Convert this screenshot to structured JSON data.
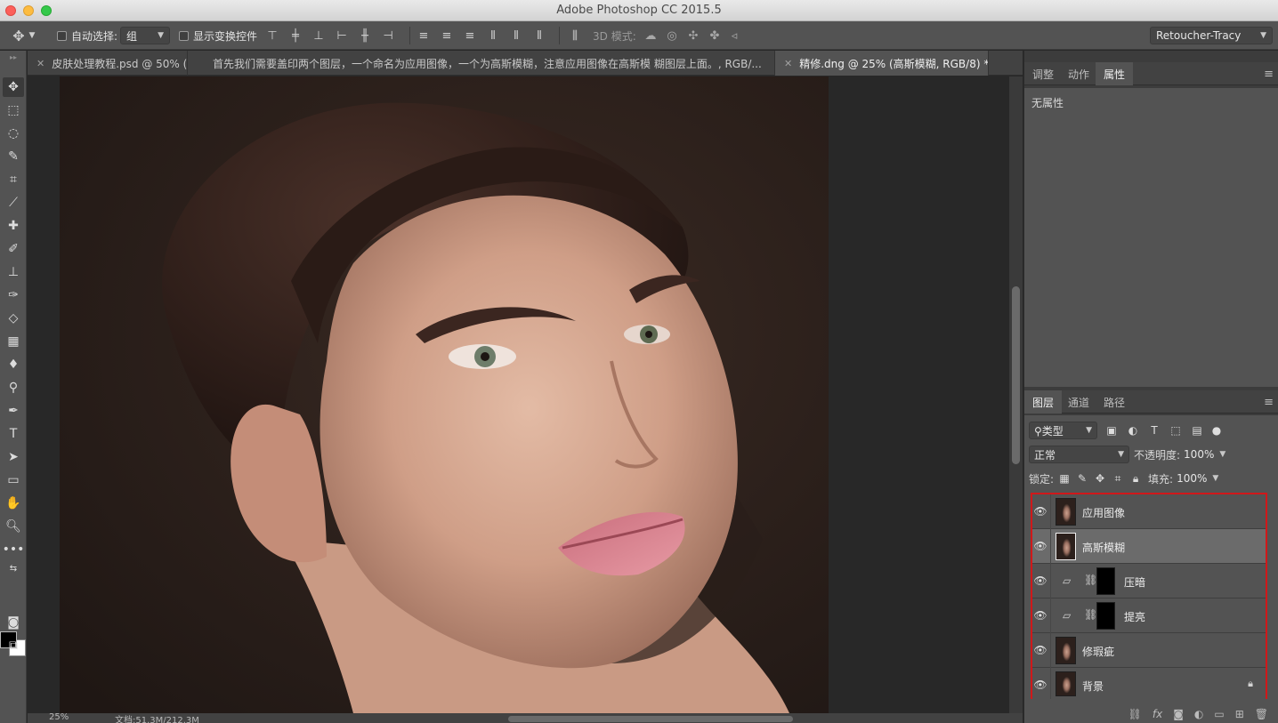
{
  "window": {
    "title": "Adobe Photoshop CC 2015.5"
  },
  "options": {
    "auto_select_label": "自动选择:",
    "auto_select_value": "组",
    "show_transform_label": "显示变换控件",
    "mode_3d_label": "3D 模式:",
    "workspace": "Retoucher-Tracy"
  },
  "document_tabs": [
    {
      "label": "皮肤处理教程.psd @ 50% (",
      "active": false
    },
    {
      "label": "首先我们需要盖印两个图层，一个命名为应用图像，一个为高斯模糊，注意应用图像在高斯模 糊图层上面。, RGB/...",
      "active": false
    },
    {
      "label": "精修.dng @ 25% (高斯模糊, RGB/8) *",
      "active": true
    }
  ],
  "status": {
    "zoom": "25%",
    "doc_size": "文档:51.3M/212.3M"
  },
  "properties_panel": {
    "tabs": [
      "调整",
      "动作",
      "属性"
    ],
    "active_tab": "属性",
    "body_text": "无属性"
  },
  "layers_panel": {
    "tabs": [
      "图层",
      "通道",
      "路径"
    ],
    "active_tab": "图层",
    "filter_kind": "类型",
    "blend_mode": "正常",
    "opacity_label": "不透明度:",
    "opacity_value": "100%",
    "lock_label": "锁定:",
    "fill_label": "填充:",
    "fill_value": "100%",
    "layers": [
      {
        "name": "应用图像",
        "kind": "pixel",
        "selected": false,
        "locked": false
      },
      {
        "name": "高斯模糊",
        "kind": "pixel",
        "selected": true,
        "locked": false
      },
      {
        "name": "压暗",
        "kind": "adjustment",
        "selected": false,
        "locked": false
      },
      {
        "name": "提亮",
        "kind": "adjustment",
        "selected": false,
        "locked": false
      },
      {
        "name": "修瑕疵",
        "kind": "pixel",
        "selected": false,
        "locked": false
      },
      {
        "name": "背景",
        "kind": "pixel",
        "selected": false,
        "locked": true
      }
    ]
  },
  "colors": {
    "highlight_border": "#d0181a",
    "panel_bg": "#535353",
    "canvas_bg": "#282828"
  }
}
